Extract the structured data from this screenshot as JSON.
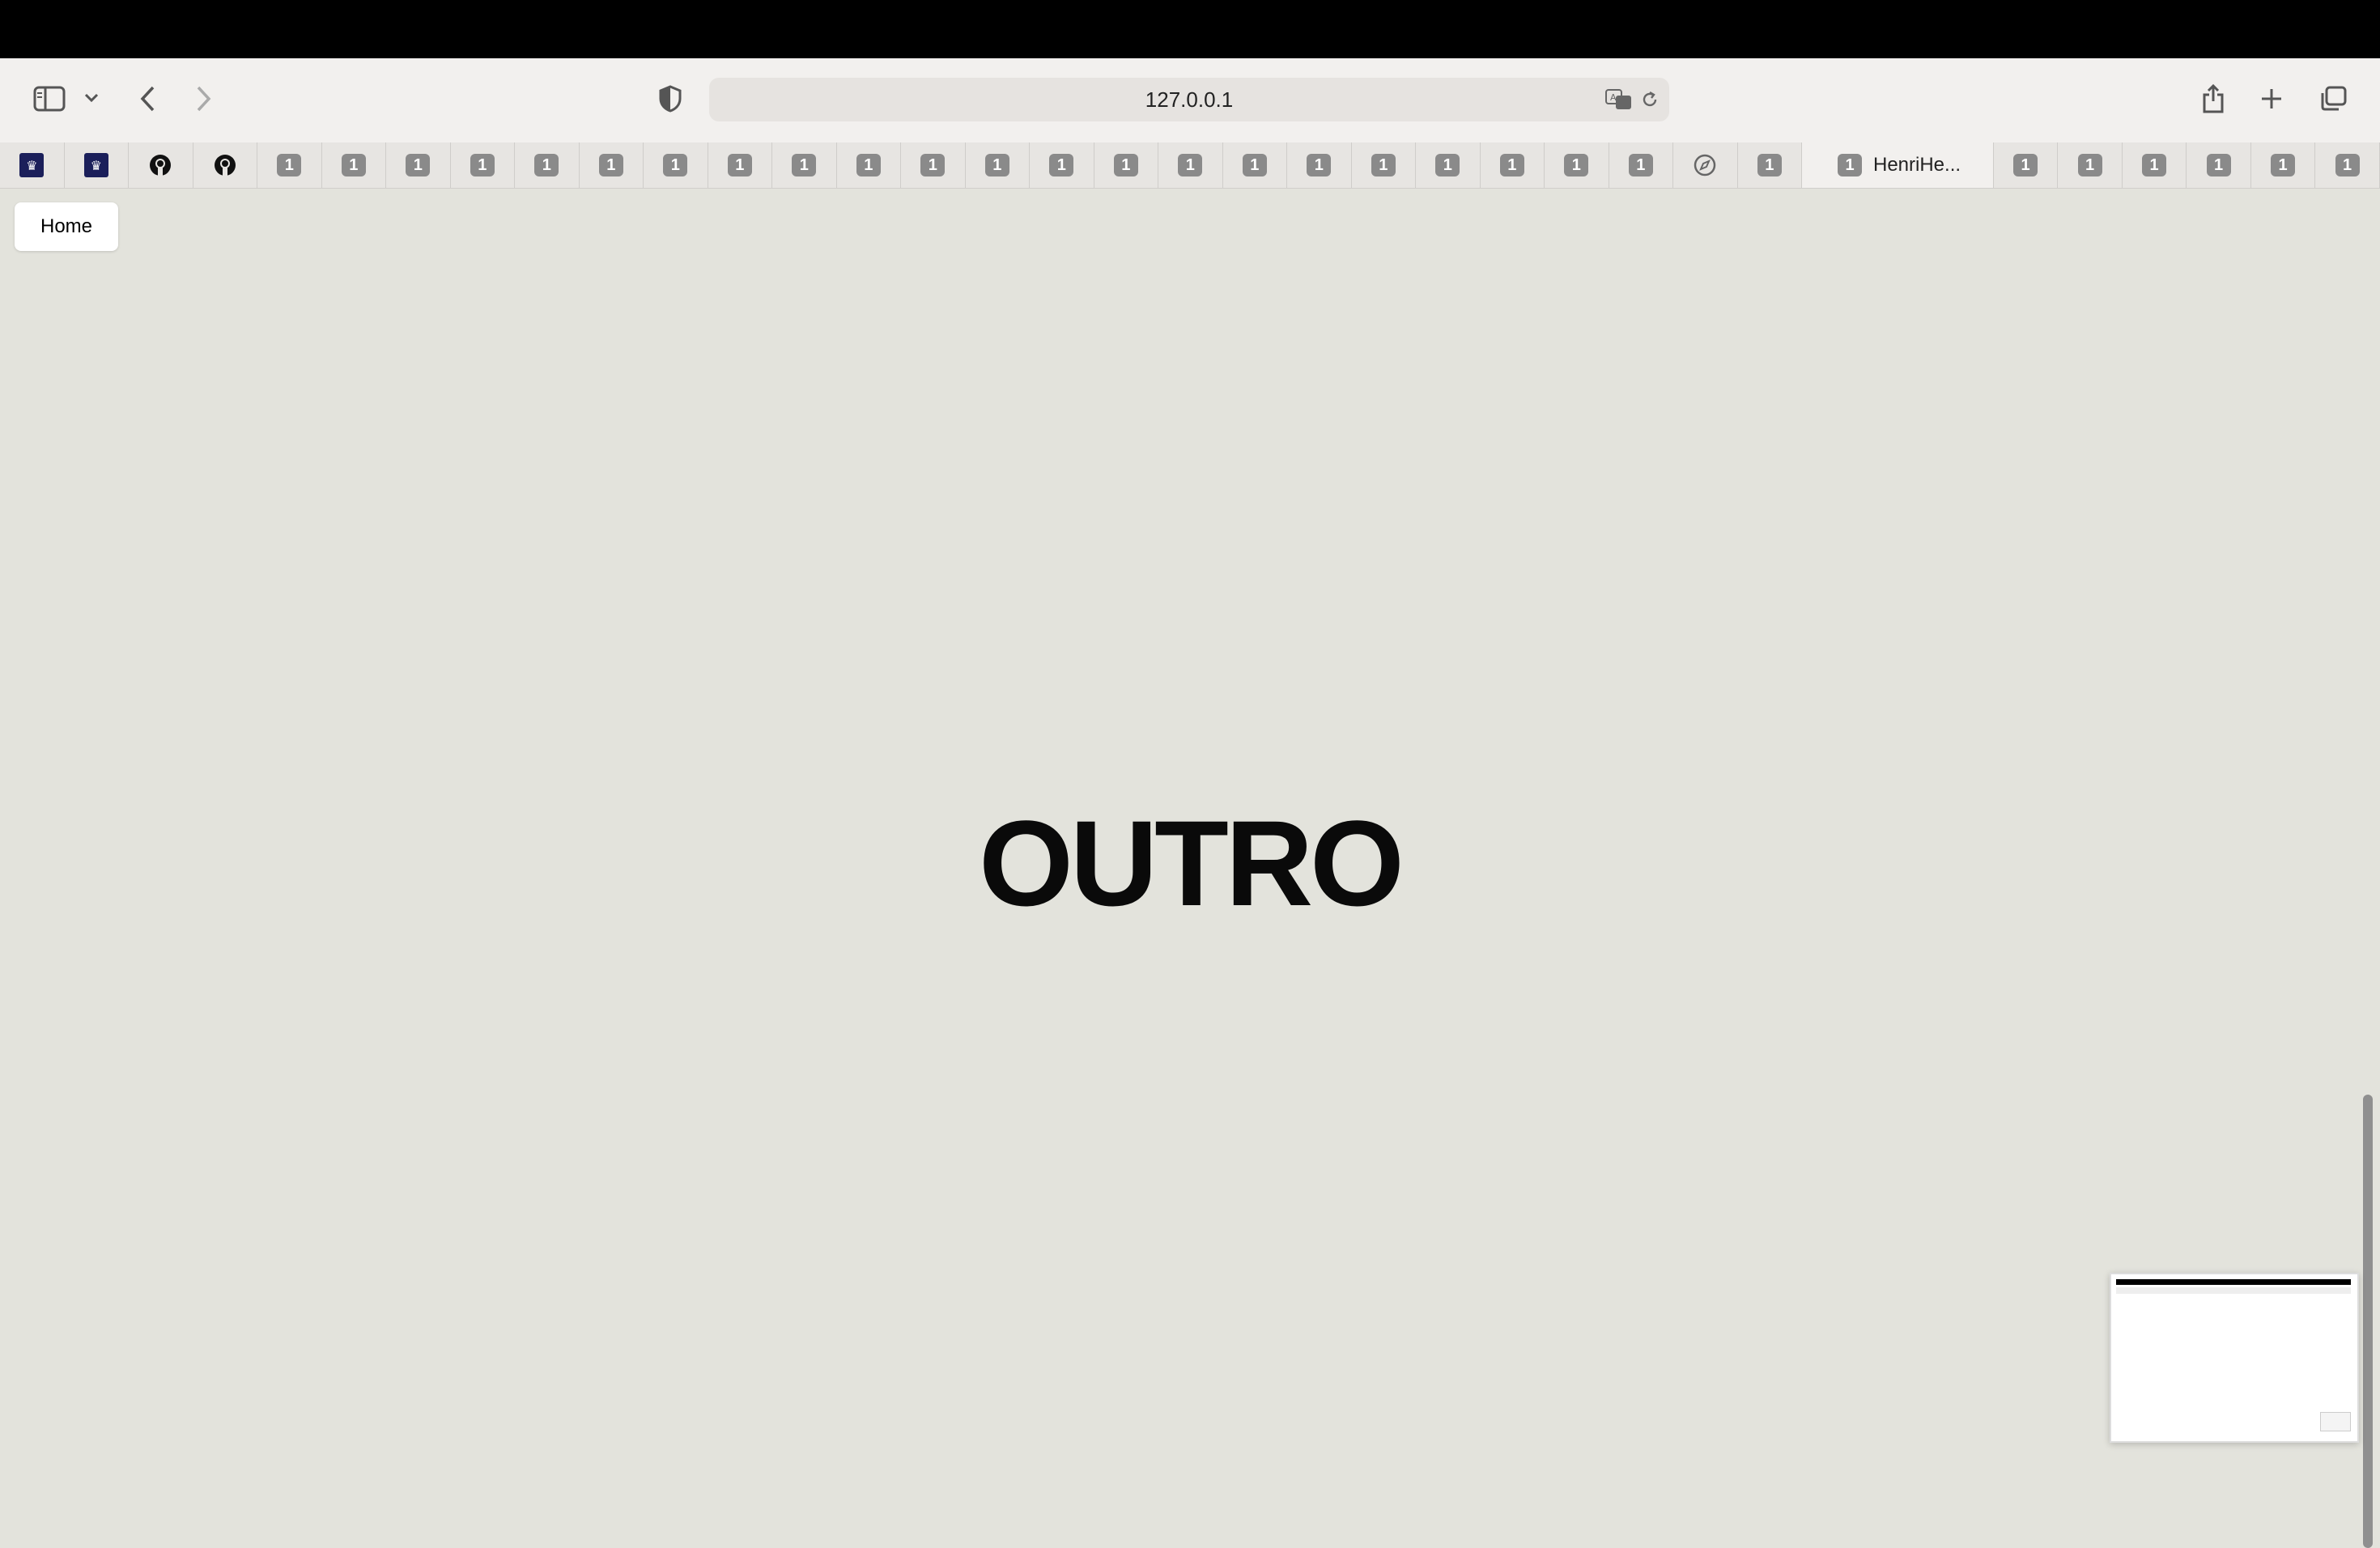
{
  "browser": {
    "url": "127.0.0.1",
    "active_tab_title": "HenriHe...",
    "tab_badge": "1"
  },
  "tabs": [
    {
      "icon": "site-favicon"
    },
    {
      "icon": "site-favicon"
    },
    {
      "icon": "github-icon"
    },
    {
      "icon": "github-icon"
    },
    {
      "icon": "badge"
    },
    {
      "icon": "badge"
    },
    {
      "icon": "badge"
    },
    {
      "icon": "badge"
    },
    {
      "icon": "badge"
    },
    {
      "icon": "badge"
    },
    {
      "icon": "badge"
    },
    {
      "icon": "badge"
    },
    {
      "icon": "badge"
    },
    {
      "icon": "badge"
    },
    {
      "icon": "badge"
    },
    {
      "icon": "badge"
    },
    {
      "icon": "badge"
    },
    {
      "icon": "badge"
    },
    {
      "icon": "badge"
    },
    {
      "icon": "badge"
    },
    {
      "icon": "badge"
    },
    {
      "icon": "badge"
    },
    {
      "icon": "badge"
    },
    {
      "icon": "badge"
    },
    {
      "icon": "badge"
    },
    {
      "icon": "badge"
    },
    {
      "icon": "compass-icon"
    },
    {
      "icon": "badge"
    },
    {
      "icon": "active"
    },
    {
      "icon": "badge"
    },
    {
      "icon": "badge"
    },
    {
      "icon": "badge"
    },
    {
      "icon": "badge"
    },
    {
      "icon": "badge"
    },
    {
      "icon": "badge"
    }
  ],
  "page": {
    "home_label": "Home",
    "title": "OUTRO"
  },
  "colors": {
    "page_background": "#e3e3dc",
    "badge": "#8a8a8a"
  }
}
